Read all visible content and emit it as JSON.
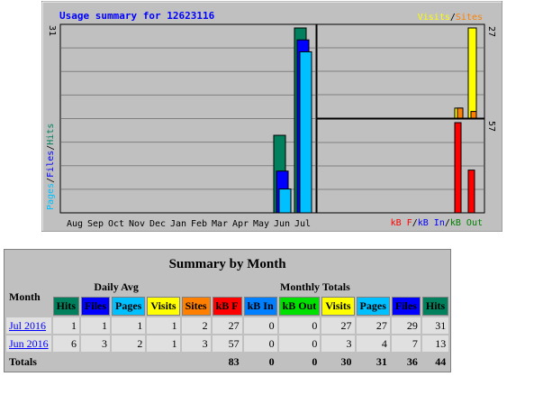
{
  "graph": {
    "title": "Usage summary for 12623116",
    "left_max": "31",
    "left_axis_labels": [
      "Pages",
      "/",
      "Files",
      "/",
      "Hits"
    ],
    "right_top_max": "27",
    "right_bottom_max": "57",
    "legend_top": [
      {
        "text": "Visits",
        "color": "#ffff00"
      },
      {
        "text": "/",
        "color": "#000000"
      },
      {
        "text": "Sites",
        "color": "#ff8000"
      }
    ],
    "legend_bottom": [
      {
        "text": "kB F",
        "color": "#ff0000"
      },
      {
        "text": "/",
        "color": "#000000"
      },
      {
        "text": "kB In",
        "color": "#0000ff"
      },
      {
        "text": "/",
        "color": "#000000"
      },
      {
        "text": "kB Out",
        "color": "#008000"
      }
    ],
    "months": [
      "Aug",
      "Sep",
      "Oct",
      "Nov",
      "Dec",
      "Jan",
      "Feb",
      "Mar",
      "Apr",
      "May",
      "Jun",
      "Jul"
    ],
    "colors": {
      "hits": "#00805c",
      "files": "#0000ff",
      "pages": "#00c0ff",
      "visits": "#ffff00",
      "sites": "#ff8000",
      "kbf": "#ff0000",
      "kbin": "#0000ff",
      "kbout": "#008000"
    }
  },
  "chart_data": {
    "type": "bar",
    "title": "Usage summary for 12623116",
    "categories": [
      "Aug",
      "Sep",
      "Oct",
      "Nov",
      "Dec",
      "Jan",
      "Feb",
      "Mar",
      "Apr",
      "May",
      "Jun",
      "Jul"
    ],
    "series": [
      {
        "name": "Hits",
        "values": [
          0,
          0,
          0,
          0,
          0,
          0,
          0,
          0,
          0,
          0,
          13,
          31
        ]
      },
      {
        "name": "Files",
        "values": [
          0,
          0,
          0,
          0,
          0,
          0,
          0,
          0,
          0,
          0,
          7,
          29
        ]
      },
      {
        "name": "Pages",
        "values": [
          0,
          0,
          0,
          0,
          0,
          0,
          0,
          0,
          0,
          0,
          4,
          27
        ]
      },
      {
        "name": "Visits",
        "values": [
          0,
          0,
          0,
          0,
          0,
          0,
          0,
          0,
          0,
          0,
          3,
          27
        ]
      },
      {
        "name": "Sites",
        "values": [
          0,
          0,
          0,
          0,
          0,
          0,
          0,
          0,
          0,
          0,
          3,
          2
        ]
      },
      {
        "name": "kB F",
        "values": [
          0,
          0,
          0,
          0,
          0,
          0,
          0,
          0,
          0,
          0,
          57,
          27
        ]
      },
      {
        "name": "kB In",
        "values": [
          0,
          0,
          0,
          0,
          0,
          0,
          0,
          0,
          0,
          0,
          0,
          0
        ]
      },
      {
        "name": "kB Out",
        "values": [
          0,
          0,
          0,
          0,
          0,
          0,
          0,
          0,
          0,
          0,
          0,
          0
        ]
      }
    ],
    "ylim_left": [
      0,
      31
    ],
    "ylim_right_top": [
      0,
      27
    ],
    "ylim_right_bottom": [
      0,
      57
    ]
  },
  "summary": {
    "title": "Summary by Month",
    "month_header": "Month",
    "daily_avg_header": "Daily Avg",
    "monthly_totals_header": "Monthly Totals",
    "daily_cols": [
      {
        "label": "Hits",
        "cls": "hits"
      },
      {
        "label": "Files",
        "cls": "files"
      },
      {
        "label": "Pages",
        "cls": "pages"
      },
      {
        "label": "Visits",
        "cls": "visits"
      }
    ],
    "monthly_cols": [
      {
        "label": "Sites",
        "cls": "sites"
      },
      {
        "label": "kB F",
        "cls": "kbf"
      },
      {
        "label": "kB In",
        "cls": "kbin"
      },
      {
        "label": "kB Out",
        "cls": "kbout"
      },
      {
        "label": "Visits",
        "cls": "visits"
      },
      {
        "label": "Pages",
        "cls": "pages"
      },
      {
        "label": "Files",
        "cls": "files"
      },
      {
        "label": "Hits",
        "cls": "hits"
      }
    ],
    "rows": [
      {
        "month": "Jul 2016",
        "values": [
          "1",
          "1",
          "1",
          "1",
          "2",
          "27",
          "0",
          "0",
          "27",
          "27",
          "29",
          "31"
        ]
      },
      {
        "month": "Jun 2016",
        "values": [
          "6",
          "3",
          "2",
          "1",
          "3",
          "57",
          "0",
          "0",
          "3",
          "4",
          "7",
          "13"
        ]
      }
    ],
    "totals": {
      "label": "Totals",
      "values": [
        "83",
        "0",
        "0",
        "30",
        "31",
        "36",
        "44"
      ]
    }
  }
}
